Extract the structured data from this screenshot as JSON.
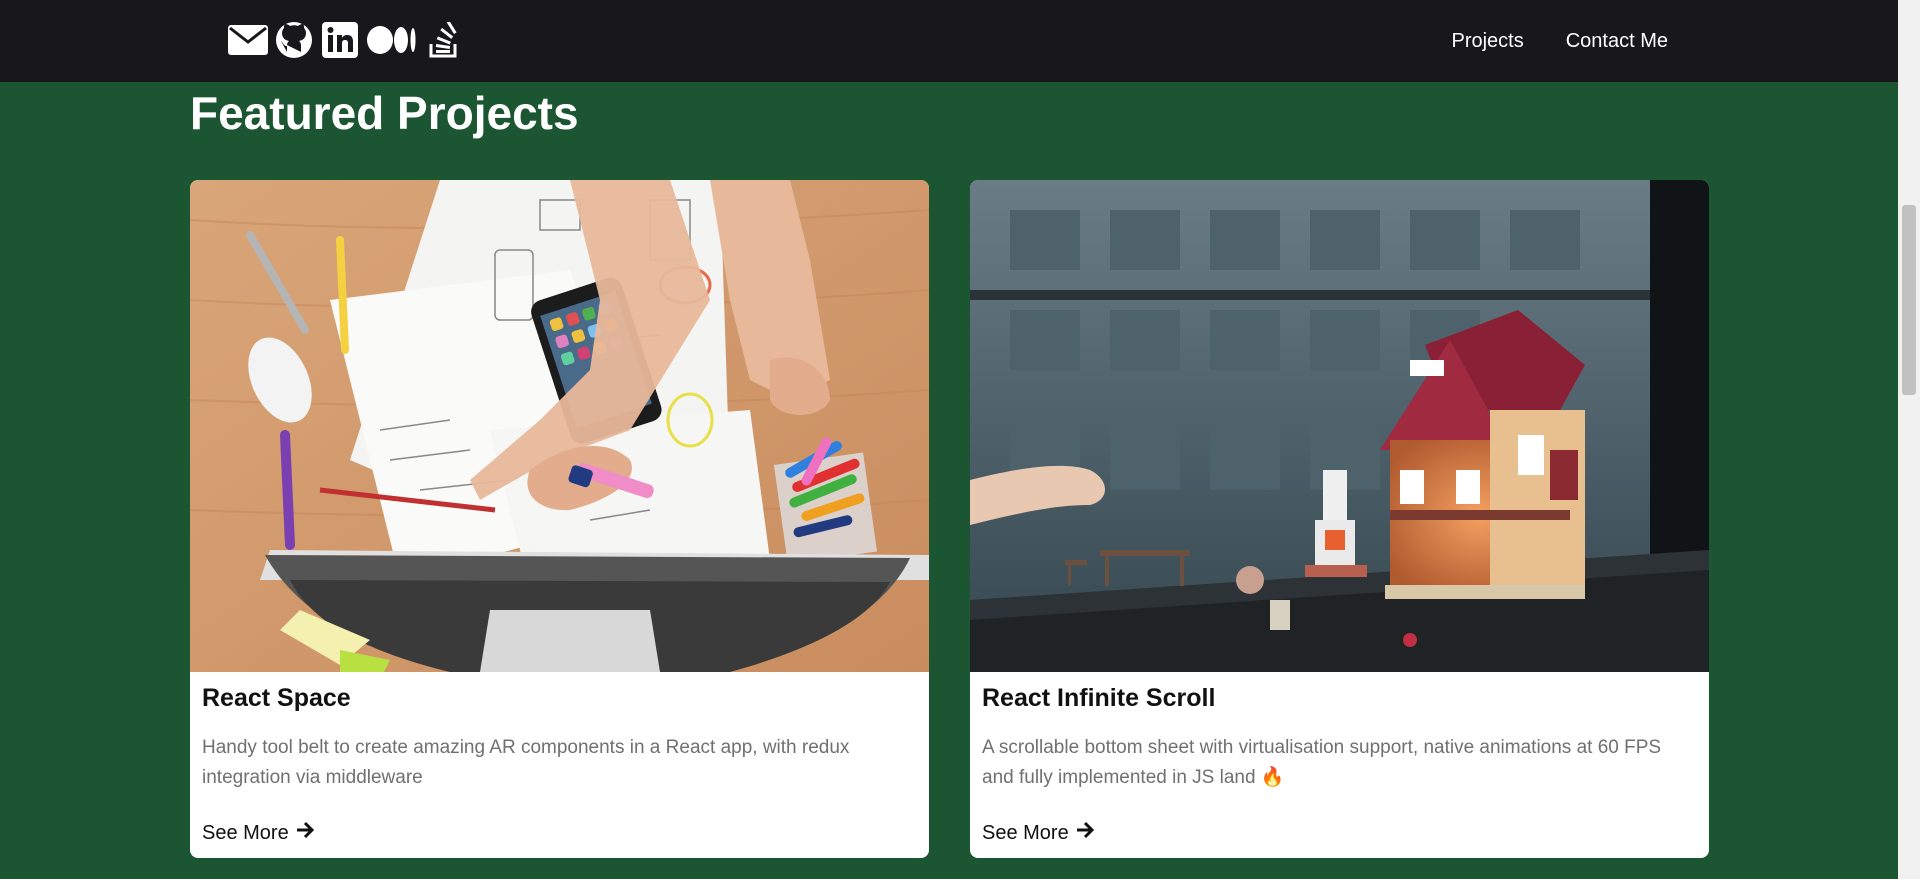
{
  "socials": [
    {
      "name": "mail-icon"
    },
    {
      "name": "github-icon"
    },
    {
      "name": "linkedin-icon"
    },
    {
      "name": "medium-icon"
    },
    {
      "name": "stackoverflow-icon"
    }
  ],
  "nav": {
    "projects": "Projects",
    "contact": "Contact Me"
  },
  "section": {
    "title": "Featured Projects"
  },
  "projects": [
    {
      "title": "React Space",
      "description": "Handy tool belt to create amazing AR components in a React app, with redux integration via middleware",
      "cta": "See More"
    },
    {
      "title": "React Infinite Scroll",
      "description": "A scrollable bottom sheet with virtualisation support, native animations at 60 FPS and fully implemented in JS land 🔥",
      "cta": "See More"
    }
  ],
  "colors": {
    "background": "#1b5532",
    "topbar": "#18181b",
    "card": "#ffffff"
  }
}
